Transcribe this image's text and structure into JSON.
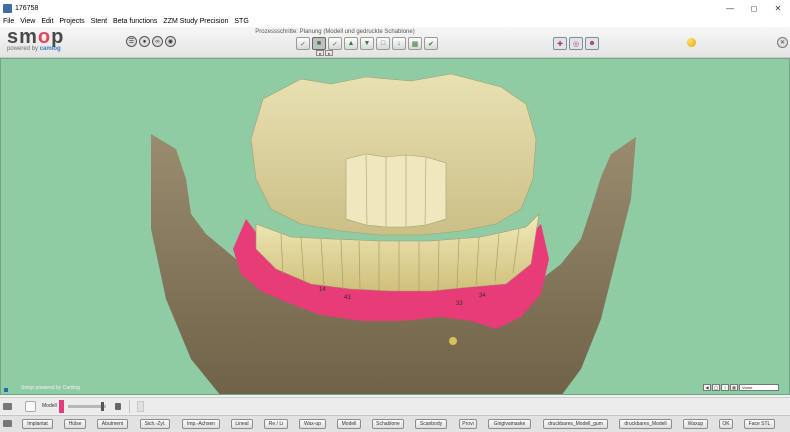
{
  "window": {
    "title": "176758",
    "minimize_icon": "minimize-icon",
    "maximize_icon": "maximize-icon",
    "close_icon": "close-icon"
  },
  "menu": [
    {
      "label": "File"
    },
    {
      "label": "View"
    },
    {
      "label": "Edit"
    },
    {
      "label": "Projects"
    },
    {
      "label": "Stent"
    },
    {
      "label": "Beta functions"
    },
    {
      "label": "ZZM Study Precision"
    },
    {
      "label": "STG"
    }
  ],
  "logo": {
    "word_start": "sm",
    "word_o": "o",
    "word_end": "p",
    "sub_prefix": "powered by ",
    "sub_brand": "camlog"
  },
  "toolbar": {
    "process_title": "Prozessschritte: Planung (Modell und gedruckte Schablone)",
    "step_count_active": 2,
    "accent_color": "#e2475f",
    "status_color": "#f2b705"
  },
  "viewport": {
    "background_color": "#8fcba3",
    "watermark": "Smop powered by Camlog",
    "view_select": "Vorne",
    "tooth_numbers": [
      "14",
      "43",
      "33",
      "34"
    ]
  },
  "model_panel": {
    "label": "Modell",
    "swatch_color": "#e63b7a",
    "opacity_fraction": 0.95
  },
  "objects": [
    "Implantat",
    "Hülse",
    "Abutment",
    "Sich.-Zyl.",
    "Imp.-Achsen",
    "Lineal",
    "Re / Li",
    "Wax-up",
    "Modell",
    "Schablone",
    "Scanbody",
    "Provi",
    "Gingivamaske",
    "druckbares_Modell_gum",
    "druckbares_Modell",
    "Waxup",
    "OK",
    "Face STL"
  ]
}
